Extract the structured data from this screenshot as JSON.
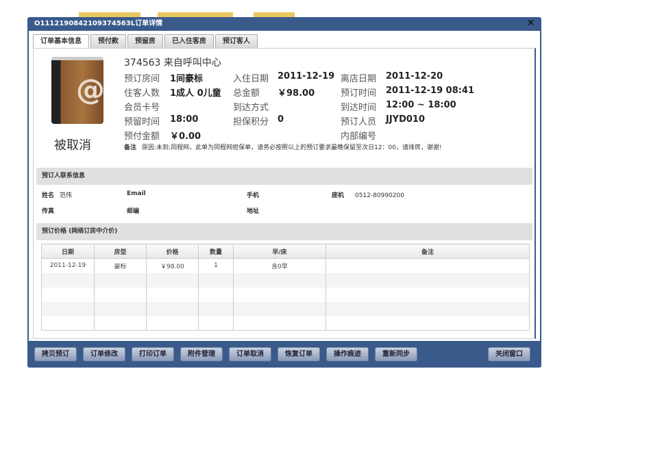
{
  "window": {
    "title": "O1112190842109374563L订单详情",
    "close": "×"
  },
  "tabs": [
    "订单基本信息",
    "预付款",
    "预留房",
    "已入住客房",
    "预订客人"
  ],
  "order": {
    "status": "被取消",
    "headline": "374563 来自呼叫中心",
    "fields": [
      {
        "label": "预订房间",
        "value": "1间豪标"
      },
      {
        "label": "入住日期",
        "value": "2011-12-19"
      },
      {
        "label": "离店日期",
        "value": "2011-12-20"
      },
      {
        "label": "住客人数",
        "value": "1成人 0儿童"
      },
      {
        "label": "总金额",
        "value": "￥98.00"
      },
      {
        "label": "预订时间",
        "value": "2011-12-19 08:41"
      },
      {
        "label": "会员卡号",
        "value": ""
      },
      {
        "label": "到达方式",
        "value": ""
      },
      {
        "label": "到达时间",
        "value": "12:00 ~ 18:00"
      },
      {
        "label": "预留时间",
        "value": "18:00"
      },
      {
        "label": "担保积分",
        "value": "0"
      },
      {
        "label": "预订人员",
        "value": "JJYD010"
      },
      {
        "label": "预付金额",
        "value": "￥0.00"
      },
      {
        "label": "内部编号",
        "value": ""
      }
    ],
    "note_label": "备注",
    "note": "原因:未到;同程网，此单为同程网担保单，请务必按照以上的预订要求最晚保留至次日12：00，请排房，谢谢!"
  },
  "contact": {
    "title": "预订人联系信息",
    "name_label": "姓名",
    "name": "范伟",
    "email_label": "Email",
    "mobile_label": "手机",
    "phone_label": "座机",
    "phone": "0512-80990200",
    "fax_label": "传真",
    "zip_label": "邮编",
    "address_label": "地址"
  },
  "price": {
    "title": "预订价格 (网络订房中介价)",
    "columns": [
      "日期",
      "房型",
      "价格",
      "数量",
      "早/床",
      "备注"
    ],
    "rows": [
      [
        "2011-12-19",
        "豪标",
        "￥98.00",
        "1",
        "含0早",
        ""
      ]
    ]
  },
  "buttons": [
    "拷贝预订",
    "订单修改",
    "打印订单",
    "附件管理",
    "订单取消",
    "恢复订单",
    "操作痕迹",
    "重新同步"
  ],
  "close_button": "关闭窗口"
}
